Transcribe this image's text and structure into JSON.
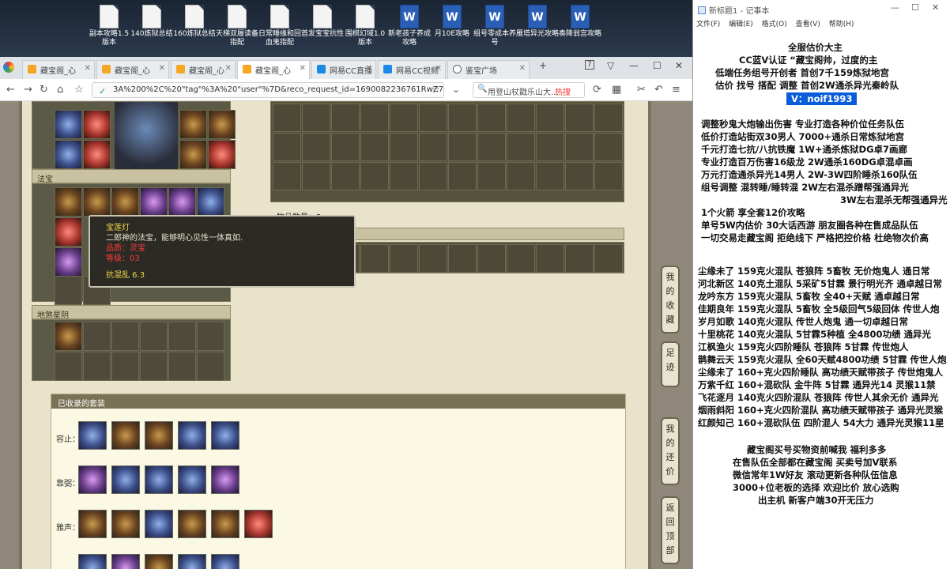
{
  "desktop": {
    "icons": [
      {
        "label": "副本攻略1.5版本",
        "type": "txt"
      },
      {
        "label": "140炼狱总结",
        "type": "txt"
      },
      {
        "label": "160炼狱总结",
        "type": "txt"
      },
      {
        "label": "天梯双履读备指配",
        "type": "txt"
      },
      {
        "label": "日常睡缘和回血鬼指配",
        "type": "txt"
      },
      {
        "label": "首发宝宝抗性",
        "type": "txt"
      },
      {
        "label": "围棋幻域1.0版本",
        "type": "txt"
      },
      {
        "label": "新老孩子养成攻略",
        "type": "doc"
      },
      {
        "label": "月10E攻略",
        "type": "doc"
      },
      {
        "label": "组号零成本养号",
        "type": "doc"
      },
      {
        "label": "雁塔异光攻略",
        "type": "doc"
      },
      {
        "label": "奏降翁宫攻略",
        "type": "doc"
      }
    ]
  },
  "browser": {
    "tabs": [
      {
        "label": "藏宝阁_心",
        "active": false,
        "icon": "fav"
      },
      {
        "label": "藏宝阁_心",
        "active": false,
        "icon": "fav"
      },
      {
        "label": "藏宝阁_心",
        "active": false,
        "icon": "fav"
      },
      {
        "label": "藏宝阁_心",
        "active": true,
        "icon": "fav"
      },
      {
        "label": "网易CC直播",
        "active": false,
        "icon": "cc"
      },
      {
        "label": "网易CC视频",
        "active": false,
        "icon": "cc"
      },
      {
        "label": "鉴宝广场",
        "active": false,
        "icon": "globe"
      }
    ],
    "url": "3A%200%2C%20\"tag\"%3A%20\"user\"%7D&reco_request_id=1690082236761RwZ7-",
    "search_placeholder": "用登山杖戳乐山大...",
    "hot_label": "热搜",
    "window_controls": [
      "7",
      "▽",
      "—",
      "☐",
      "✕"
    ]
  },
  "game": {
    "panel_fabao_title": "法宝",
    "panel_diyin_title": "地煞星阴",
    "tooltip": {
      "name": "宝莲灯",
      "desc": "二郎神的法宝，能够明心见性一体真如.",
      "red1": "品质：灵宝",
      "red2": "等级：03",
      "stat": "抗混乱 6.3"
    },
    "partial_label": "物品数量：5",
    "collected_title": "已收录的套装",
    "sets": [
      {
        "label": "容止："
      },
      {
        "label": "靠弼："
      },
      {
        "label": "雅声："
      }
    ],
    "side_buttons": [
      "我的收藏",
      "足迹",
      "我的还价",
      "返回顶部"
    ]
  },
  "notepad": {
    "title": "新标题1 - 记事本",
    "menu": [
      "文件(F)",
      "编辑(E)",
      "格式(O)",
      "查看(V)",
      "帮助(H)"
    ],
    "lines": [
      "全服估价大主",
      "CC蓝V认证 “藏宝阁帅，过度的主",
      "低端任务组号开创者          首创7千159炼狱地宫",
      "估价 找号 搭配 调整          首创2W通杀异光秦岭队",
      "V：noif1993",
      "调整秒鬼大炮输出伤害          专业打造各种价位任务队伍",
      "低价打造站街双30男人            7000+通杀日常炼狱地宫",
      "千元打造七抗/八抗铁魔           1W+通杀炼狱DG卓7画廊",
      "专业打造百万伤害16级龙           2W通杀160DG卓混卓画",
      "万元打造通杀异光14男人         2W-3W四阶睡杀160队伍",
      "组号调整 混转睡/睡转混             2W左右混杀蹭帮强通异光",
      "3W左右混杀无帮强通异光",
      "1个火箭 享全套12价攻略",
      "单号5W内估价 30大话西游          朋友圈各种在售成品队伍",
      "一切交易走藏宝阁 拒绝线下      严格把控价格 杜绝物次价高",
      "尘缘未了 159克火混队 苍狼阵 5畜牧 无价炮鬼人 通日常",
      "河北新区 140克土混队 5采矿5甘霖 景行明光齐 通卓越日常",
      "龙吟东方 159克火混队 5畜牧 全40+天赋 通卓越日常",
      "佳期良年 159克火混队 5畜牧 全5级回气5级回体 传世人炮",
      "岁月如歌 140克火混队 传世人炮鬼 通一切卓越日常",
      "十里桃花 140克火混队 5甘霖5种植 全4800功绩 通异光",
      "江枫渔火 159克火四阶睡队 苍狼阵 5甘霖 传世炮人",
      "鹊舞云天 159克火混队 全60天赋4800功绩 5甘霖 传世人炮",
      "尘缘未了 160+克火四阶睡队 高功绩天赋带孩子 传世炮鬼人",
      "万紫千红 160+混砍队 金牛阵 5甘霖 通异光14 灵猴11禁",
      "飞花逐月 140克火四阶混队 苍狼阵 传世人其余无价 通异光",
      "烟雨斜阳 160+克火四阶混队 高功绩天赋带孩子 通异光灵猴",
      "红颜知己 160+混砍队伍 四阶混人 54大力 通异光灵猴11星",
      "藏宝阁买号买物资前喊我 福利多多",
      "在售队伍全部都在藏宝阁 买卖号加V联系",
      "微信常年1W好友 滚动更新各种队伍信息",
      "3000+位老板的选择 欢迎比价 放心选购",
      "出主机 新客户端30开无压力"
    ]
  }
}
